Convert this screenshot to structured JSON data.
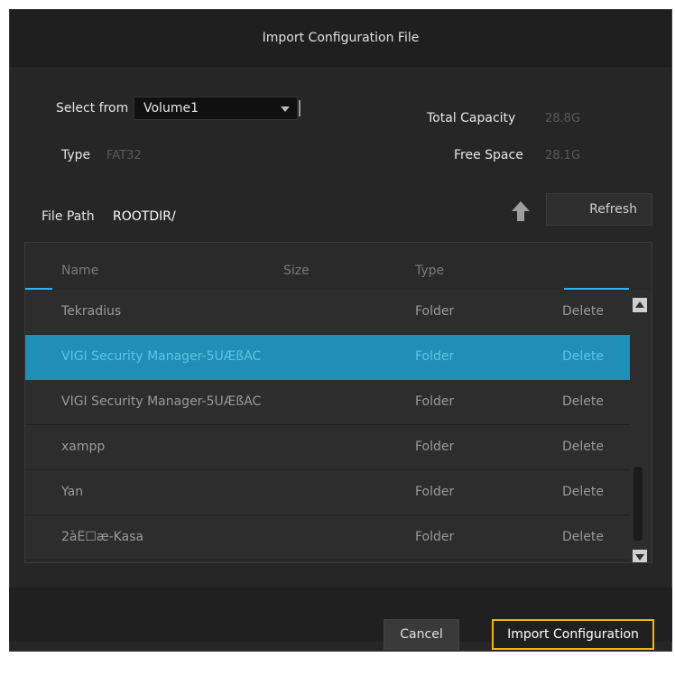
{
  "dialog": {
    "title": "Import Configuration File",
    "select_from": {
      "label": "Select from",
      "value": "Volume1"
    },
    "type": {
      "label": "Type",
      "value": "FAT32"
    },
    "total_capacity": {
      "label": "Total Capacity",
      "value": "28.8G"
    },
    "free_space": {
      "label": "Free Space",
      "value": "28.1G"
    },
    "file_path": {
      "label": "File Path",
      "value": "ROOTDIR/"
    },
    "refresh_label": "Refresh",
    "table": {
      "headers": [
        "Name",
        "Size",
        "Type"
      ],
      "rows": [
        {
          "name": "Tekradius",
          "type": "Folder",
          "action": "Delete",
          "selected": false
        },
        {
          "name": "VIGI Security Manager-5ÜÆßÄC",
          "type": "Folder",
          "action": "Delete",
          "selected": true
        },
        {
          "name": "VIGI Security Manager-5ÜÆßÄC",
          "type": "Folder",
          "action": "Delete",
          "selected": false
        },
        {
          "name": "xampp",
          "type": "Folder",
          "action": "Delete",
          "selected": false
        },
        {
          "name": "Yan",
          "type": "Folder",
          "action": "Delete",
          "selected": false
        },
        {
          "name": "2àÊ☐æ-Kasa",
          "type": "Folder",
          "action": "Delete",
          "selected": false
        }
      ]
    },
    "cancel_label": "Cancel",
    "import_label": "Import Configuration"
  },
  "colors": {
    "accent": "#29b6f6",
    "selected_row": "#1f8fb7",
    "import_border": "#f2b705",
    "background": "#262626"
  }
}
